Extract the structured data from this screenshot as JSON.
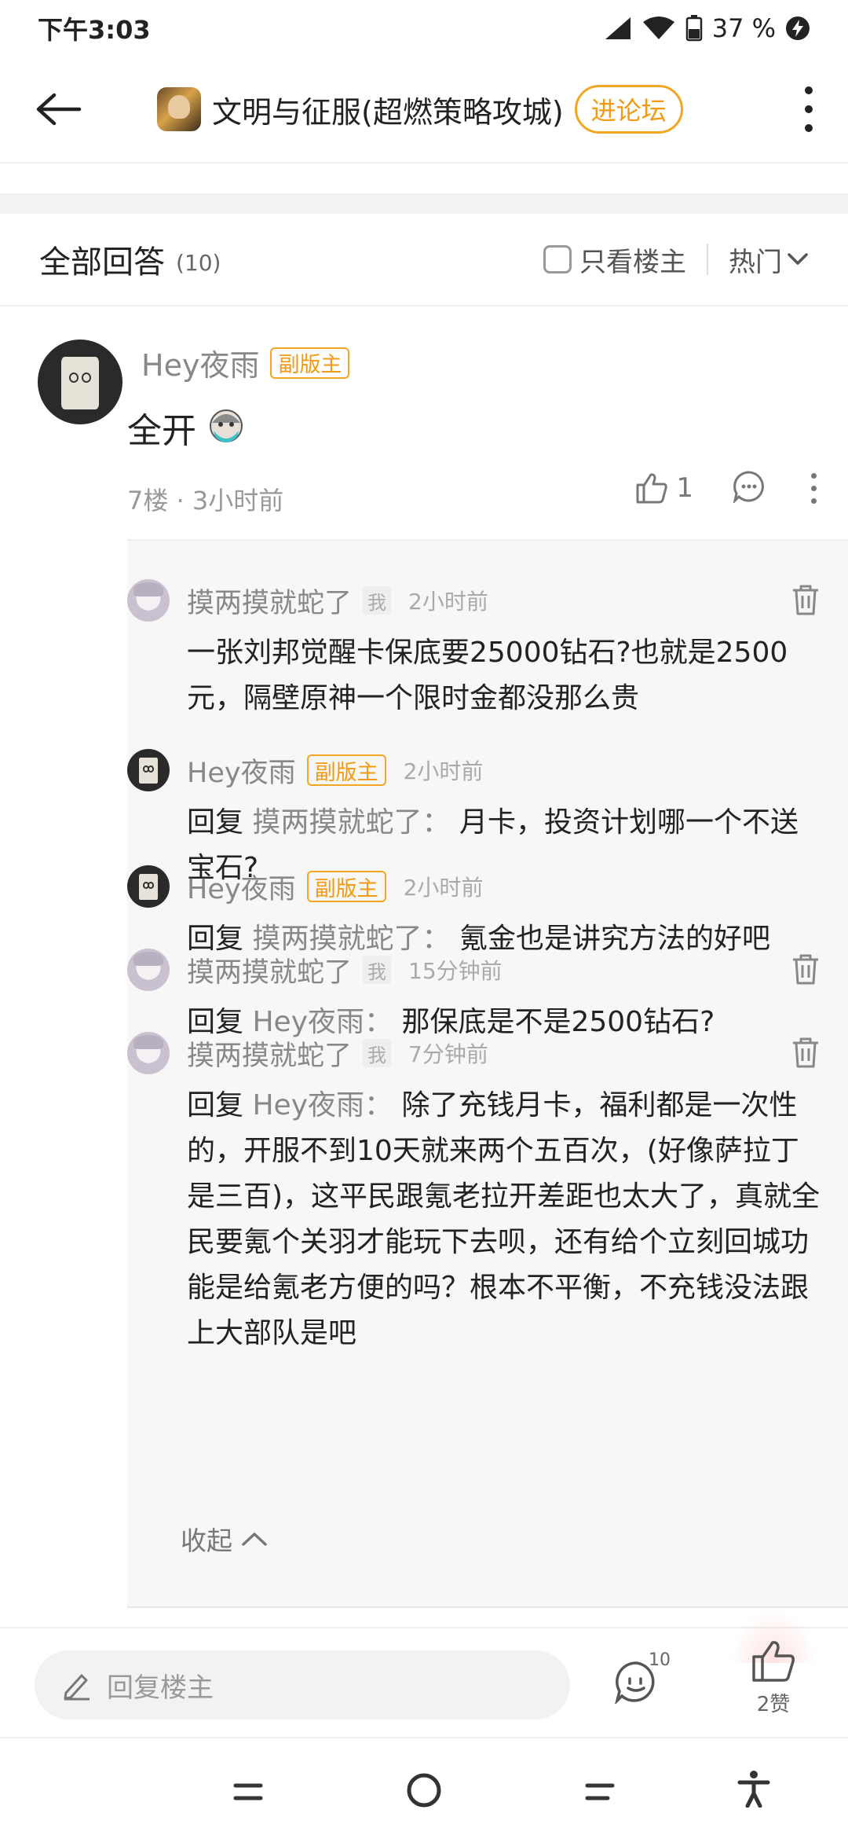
{
  "status_bar": {
    "time": "下午3:03",
    "battery": "37 %"
  },
  "nav": {
    "title": "文明与征服(超燃策略攻城)",
    "forum_button": "进论坛"
  },
  "answers_header": {
    "title": "全部回答",
    "count": "(10)",
    "only_owner_label": "只看楼主",
    "sort_label": "热门"
  },
  "post": {
    "username": "Hey夜雨",
    "badge": "副版主",
    "content": "全开",
    "meta": "7楼 · 3小时前",
    "like_count": "1"
  },
  "replies": [
    {
      "username": "摸两摸就蛇了",
      "me_tag": "我",
      "time": "2小时前",
      "text": "一张刘邦觉醒卡保底要25000钻石?也就是2500元，隔壁原神一个限时金都没那么贵"
    },
    {
      "username": "Hey夜雨",
      "badge": "副版主",
      "time": "2小时前",
      "prefix": "回复",
      "target": "摸两摸就蛇了",
      "colon": "：",
      "text": "月卡，投资计划哪一个不送宝石?"
    },
    {
      "username": "Hey夜雨",
      "badge": "副版主",
      "time": "2小时前",
      "prefix": "回复",
      "target": "摸两摸就蛇了",
      "colon": "：",
      "text": "氪金也是讲究方法的好吧"
    },
    {
      "username": "摸两摸就蛇了",
      "me_tag": "我",
      "time": "15分钟前",
      "prefix": "回复",
      "target": "Hey夜雨",
      "colon": "：",
      "text": "那保底是不是2500钻石?"
    },
    {
      "username": "摸两摸就蛇了",
      "me_tag": "我",
      "time": "7分钟前",
      "prefix": "回复",
      "target": "Hey夜雨",
      "colon": "：",
      "text": "除了充钱月卡，福利都是一次性的，开服不到10天就来两个五百次，(好像萨拉丁是三百)，这平民跟氪老拉开差距也太大了，真就全民要氪个关羽才能玩下去呗，还有给个立刻回城功能是给氪老方便的吗？根本不平衡，不充钱没法跟上大部队是吧"
    }
  ],
  "collapse_label": "收起",
  "bottom_bar": {
    "reply_placeholder": "回复楼主",
    "comments_count": "10",
    "likes_label": "2赞"
  },
  "colors": {
    "accent_orange": "#f29a12",
    "muted_text": "#888888",
    "panel_bg": "#f7f7f7"
  }
}
